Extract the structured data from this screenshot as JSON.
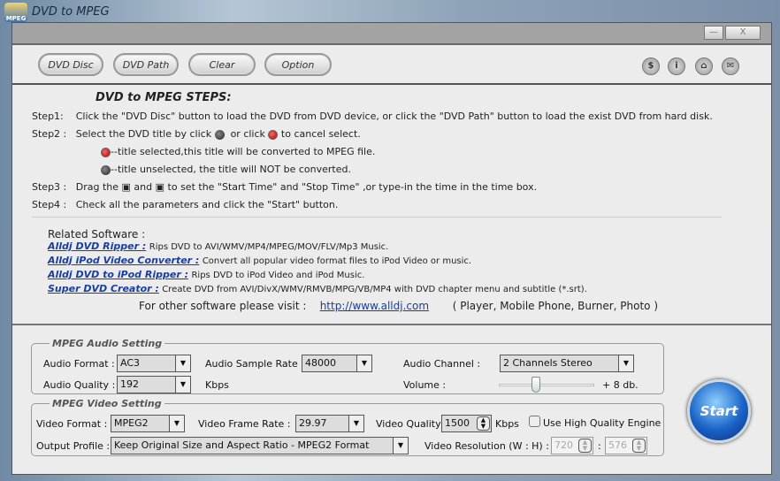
{
  "window": {
    "title": "DVD to MPEG",
    "logo_text": "MPEG",
    "minimize": "—",
    "close": "X"
  },
  "toolbar": {
    "buttons": [
      "DVD Disc",
      "DVD Path",
      "Clear",
      "Option"
    ],
    "icons": [
      "dollar-icon",
      "user-icon",
      "home-icon",
      "mail-icon"
    ],
    "icon_glyphs": [
      "$",
      "i",
      "⌂",
      "✉"
    ]
  },
  "steps": {
    "heading": "DVD to MPEG STEPS:",
    "step1_label": "Step1:",
    "step1": "Click the \"DVD Disc\" button to load the DVD from DVD device, or click the \"DVD Path\" button to load the exist DVD from hard disk.",
    "step2_label": "Step2 :",
    "step2_a": "Select the DVD title by click",
    "step2_b": "or click",
    "step2_c": "to cancel select.",
    "sel_note": "--title selected,this title will be converted to MPEG file.",
    "unsel_note": "--title unselected, the title will NOT be converted.",
    "step3_label": "Step3 :",
    "step3_a": "Drag the",
    "step3_b": "and",
    "step3_c": "to set the \"Start Time\" and \"Stop Time\" ,or type-in the time in the time box.",
    "step4_label": "Step4 :",
    "step4": "Check all the parameters and click the \"Start\" button."
  },
  "related": {
    "heading": "Related Software :",
    "items": [
      {
        "name": "Alldj DVD Ripper :",
        "desc": "Rips DVD to AVI/WMV/MP4/MPEG/MOV/FLV/Mp3 Music."
      },
      {
        "name": "Alldj iPod Video Converter :",
        "desc": "Convert all popular video format files to iPod Video or music."
      },
      {
        "name": "Alldj DVD to iPod Ripper :",
        "desc": "Rips DVD to iPod Video and iPod Music."
      },
      {
        "name": "Super DVD Creator :",
        "desc": "Create DVD from AVI/DivX/WMV/RMVB/MPG/VB/MP4 with DVD chapter menu and subtitle (*.srt)."
      }
    ],
    "visit": "For other software please visit :",
    "url": "http://www.alldj.com",
    "visit_tail": "( Player, Mobile Phone, Burner, Photo )"
  },
  "audio": {
    "legend": "MPEG Audio Setting",
    "format_label": "Audio Format :",
    "format": "AC3",
    "rate_label": "Audio Sample Rate :",
    "rate": "48000",
    "channel_label": "Audio Channel :",
    "channel": "2 Channels Stereo",
    "quality_label": "Audio Quality :",
    "quality": "192",
    "quality_unit": "Kbps",
    "volume_label": "Volume :",
    "volume_text": "+ 8 db.",
    "volume_level": 0.38
  },
  "video": {
    "legend": "MPEG Video Setting",
    "format_label": "Video Format :",
    "format": "MPEG2",
    "fps_label": "Video Frame Rate :",
    "fps": "29.97",
    "quality_label": "Video Quality :",
    "quality": "1500",
    "quality_unit": "Kbps",
    "hq_label": "Use High Quality Engine",
    "hq_checked": false,
    "profile_label": "Output Profile :",
    "profile": "Keep Original Size and Aspect Ratio - MPEG2 Format",
    "res_label": "Video Resolution (W : H) :",
    "width": "720",
    "height": "576",
    "colon": ":"
  },
  "start": "Start"
}
